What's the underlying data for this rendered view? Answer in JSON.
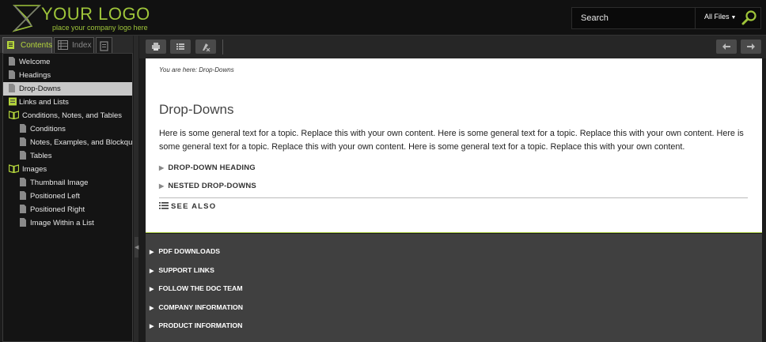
{
  "header": {
    "logo_title": "YOUR LOGO",
    "logo_tagline": "place your company logo here",
    "search_placeholder": "Search",
    "search_filter": "All Files"
  },
  "left_pane": {
    "tabs": {
      "contents": "Contents",
      "index": "Index"
    },
    "toc": [
      {
        "label": "Welcome",
        "level": 0,
        "icon": "page-icon",
        "selected": false
      },
      {
        "label": "Headings",
        "level": 0,
        "icon": "page-icon",
        "selected": false
      },
      {
        "label": "Drop-Downs",
        "level": 0,
        "icon": "page-icon",
        "selected": true
      },
      {
        "label": "Links and Lists",
        "level": 0,
        "icon": "closed-book-icon",
        "selected": false
      },
      {
        "label": "Conditions, Notes, and Tables",
        "level": 0,
        "icon": "open-book-icon",
        "selected": false
      },
      {
        "label": "Conditions",
        "level": 1,
        "icon": "page-icon",
        "selected": false
      },
      {
        "label": "Notes, Examples, and Blockquotes",
        "level": 1,
        "icon": "page-icon",
        "selected": false
      },
      {
        "label": "Tables",
        "level": 1,
        "icon": "page-icon",
        "selected": false
      },
      {
        "label": "Images",
        "level": 0,
        "icon": "open-book-icon",
        "selected": false
      },
      {
        "label": "Thumbnail Image",
        "level": 1,
        "icon": "page-icon",
        "selected": false
      },
      {
        "label": "Positioned Left",
        "level": 1,
        "icon": "page-icon",
        "selected": false
      },
      {
        "label": "Positioned Right",
        "level": 1,
        "icon": "page-icon",
        "selected": false
      },
      {
        "label": "Image Within a List",
        "level": 1,
        "icon": "page-icon",
        "selected": false
      }
    ]
  },
  "toolbar": {
    "buttons": [
      "print-icon",
      "toggle-list-icon",
      "remove-highlight-icon"
    ],
    "nav_buttons": [
      "back-arrow-icon",
      "forward-arrow-icon"
    ]
  },
  "content": {
    "breadcrumb": "You are here: Drop-Downs",
    "title": "Drop-Downs",
    "body": "Here is some general text for a topic. Replace this with your own content. Here is some general text for a topic. Replace this with your own content. Here is some general text for a topic. Replace this with your own content. Here is some general text for a topic. Replace this with your own content.",
    "dropdowns": [
      "DROP-DOWN HEADING",
      "NESTED DROP-DOWNS"
    ],
    "see_also": "SEE ALSO"
  },
  "footer": {
    "items": [
      "PDF DOWNLOADS",
      "SUPPORT LINKS",
      "FOLLOW THE DOC TEAM",
      "COMPANY INFORMATION",
      "PRODUCT INFORMATION"
    ]
  },
  "colors": {
    "accent": "#9fc53a",
    "header_bg": "#111111",
    "footer_bg": "#404040",
    "selected_bg": "#c8c8c8"
  }
}
